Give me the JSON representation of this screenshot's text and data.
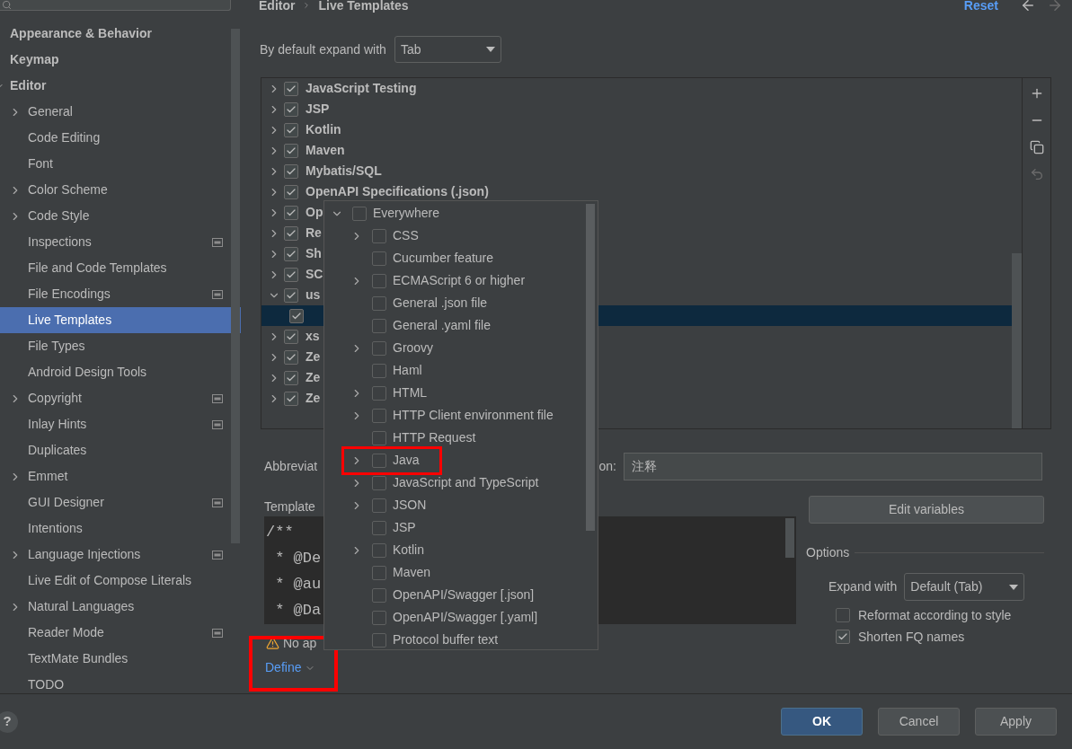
{
  "sidebar": {
    "items": [
      {
        "label": "Appearance & Behavior",
        "selected": false
      },
      {
        "label": "Keymap",
        "selected": false
      },
      {
        "label": "Editor",
        "selected": false,
        "expanded": true,
        "children": [
          {
            "label": "General",
            "expandable": true,
            "project_icon": false,
            "selected": false
          },
          {
            "label": "Code Editing",
            "expandable": false,
            "project_icon": false,
            "selected": false
          },
          {
            "label": "Font",
            "expandable": false,
            "project_icon": false,
            "selected": false
          },
          {
            "label": "Color Scheme",
            "expandable": true,
            "project_icon": false,
            "selected": false
          },
          {
            "label": "Code Style",
            "expandable": true,
            "project_icon": false,
            "selected": false
          },
          {
            "label": "Inspections",
            "expandable": false,
            "project_icon": true,
            "selected": false
          },
          {
            "label": "File and Code Templates",
            "expandable": false,
            "project_icon": false,
            "selected": false
          },
          {
            "label": "File Encodings",
            "expandable": false,
            "project_icon": true,
            "selected": false
          },
          {
            "label": "Live Templates",
            "expandable": false,
            "project_icon": false,
            "selected": true
          },
          {
            "label": "File Types",
            "expandable": false,
            "project_icon": false,
            "selected": false
          },
          {
            "label": "Android Design Tools",
            "expandable": false,
            "project_icon": false,
            "selected": false
          },
          {
            "label": "Copyright",
            "expandable": true,
            "project_icon": true,
            "selected": false
          },
          {
            "label": "Inlay Hints",
            "expandable": false,
            "project_icon": true,
            "selected": false
          },
          {
            "label": "Duplicates",
            "expandable": false,
            "project_icon": false,
            "selected": false
          },
          {
            "label": "Emmet",
            "expandable": true,
            "project_icon": false,
            "selected": false
          },
          {
            "label": "GUI Designer",
            "expandable": false,
            "project_icon": true,
            "selected": false
          },
          {
            "label": "Intentions",
            "expandable": false,
            "project_icon": false,
            "selected": false
          },
          {
            "label": "Language Injections",
            "expandable": true,
            "project_icon": true,
            "selected": false
          },
          {
            "label": "Live Edit of Compose Literals",
            "expandable": false,
            "project_icon": false,
            "selected": false
          },
          {
            "label": "Natural Languages",
            "expandable": true,
            "project_icon": false,
            "selected": false
          },
          {
            "label": "Reader Mode",
            "expandable": false,
            "project_icon": true,
            "selected": false
          },
          {
            "label": "TextMate Bundles",
            "expandable": false,
            "project_icon": false,
            "selected": false
          },
          {
            "label": "TODO",
            "expandable": false,
            "project_icon": false,
            "selected": false
          }
        ]
      }
    ]
  },
  "breadcrumb": [
    "Editor",
    "Live Templates"
  ],
  "reset_link": "Reset",
  "expand_default": {
    "label": "By default expand with",
    "value": "Tab"
  },
  "template_groups": [
    {
      "label": "JavaScript Testing",
      "checked": true,
      "expanded": false,
      "selected": false
    },
    {
      "label": "JSP",
      "checked": true,
      "expanded": false,
      "selected": false
    },
    {
      "label": "Kotlin",
      "checked": true,
      "expanded": false,
      "selected": false
    },
    {
      "label": "Maven",
      "checked": true,
      "expanded": false,
      "selected": false
    },
    {
      "label": "Mybatis/SQL",
      "checked": true,
      "expanded": false,
      "selected": false
    },
    {
      "label": "OpenAPI Specifications (.json)",
      "checked": true,
      "expanded": false,
      "selected": false
    },
    {
      "label": "Op",
      "checked": true,
      "expanded": false,
      "selected": false
    },
    {
      "label": "Re",
      "checked": true,
      "expanded": false,
      "selected": false
    },
    {
      "label": "Sh",
      "checked": true,
      "expanded": false,
      "selected": false
    },
    {
      "label": "SC",
      "checked": true,
      "expanded": false,
      "selected": false
    },
    {
      "label": "us",
      "checked": true,
      "expanded": true,
      "selected": false,
      "children": [
        {
          "checked": true,
          "selected": true
        }
      ]
    },
    {
      "label": "xs",
      "checked": true,
      "expanded": false,
      "selected": false
    },
    {
      "label": "Ze",
      "checked": true,
      "expanded": false,
      "selected": false
    },
    {
      "label": "Ze",
      "checked": true,
      "expanded": false,
      "selected": false
    },
    {
      "label": "Ze",
      "checked": true,
      "expanded": false,
      "selected": false
    }
  ],
  "abbreviation_label": "Abbreviat",
  "description": {
    "label": "on:",
    "value": "注释"
  },
  "template_text": {
    "label": "Template",
    "lines": [
      "/**",
      " * @De",
      " * @au",
      " * @Da"
    ]
  },
  "warning": "No ap",
  "define_link": {
    "label": "Define",
    "highlighted": true
  },
  "edit_variables_button": "Edit variables",
  "options": {
    "title": "Options",
    "expand_label": "Expand with",
    "expand_value": "Default (Tab)",
    "checkboxes": [
      {
        "label": "Reformat according to style",
        "checked": false
      },
      {
        "label": "Shorten FQ names",
        "checked": true
      }
    ]
  },
  "context_popup": {
    "label": "Everywhere",
    "checked": false,
    "expanded": true,
    "children": [
      {
        "label": "CSS",
        "expandable": true,
        "checked": false,
        "highlighted": false
      },
      {
        "label": "Cucumber feature",
        "expandable": false,
        "checked": false,
        "highlighted": false
      },
      {
        "label": "ECMAScript 6 or higher",
        "expandable": true,
        "checked": false,
        "highlighted": false
      },
      {
        "label": "General .json file",
        "expandable": false,
        "checked": false,
        "highlighted": false
      },
      {
        "label": "General .yaml file",
        "expandable": false,
        "checked": false,
        "highlighted": false
      },
      {
        "label": "Groovy",
        "expandable": true,
        "checked": false,
        "highlighted": false
      },
      {
        "label": "Haml",
        "expandable": false,
        "checked": false,
        "highlighted": false
      },
      {
        "label": "HTML",
        "expandable": true,
        "checked": false,
        "highlighted": false
      },
      {
        "label": "HTTP Client environment file",
        "expandable": true,
        "checked": false,
        "highlighted": false
      },
      {
        "label": "HTTP Request",
        "expandable": false,
        "checked": false,
        "highlighted": false
      },
      {
        "label": "Java",
        "expandable": true,
        "checked": false,
        "highlighted": true
      },
      {
        "label": "JavaScript and TypeScript",
        "expandable": true,
        "checked": false,
        "highlighted": false
      },
      {
        "label": "JSON",
        "expandable": true,
        "checked": false,
        "highlighted": false
      },
      {
        "label": "JSP",
        "expandable": false,
        "checked": false,
        "highlighted": false
      },
      {
        "label": "Kotlin",
        "expandable": true,
        "checked": false,
        "highlighted": false
      },
      {
        "label": "Maven",
        "expandable": false,
        "checked": false,
        "highlighted": false
      },
      {
        "label": "OpenAPI/Swagger [.json]",
        "expandable": false,
        "checked": false,
        "highlighted": false
      },
      {
        "label": "OpenAPI/Swagger [.yaml]",
        "expandable": false,
        "checked": false,
        "highlighted": false
      },
      {
        "label": "Protocol buffer text",
        "expandable": false,
        "checked": false,
        "highlighted": false
      }
    ]
  },
  "help_button": "?",
  "dialog_buttons": [
    {
      "label": "OK",
      "kind": "primary"
    },
    {
      "label": "Cancel",
      "kind": "secondary"
    },
    {
      "label": "Apply",
      "kind": "secondary"
    }
  ]
}
